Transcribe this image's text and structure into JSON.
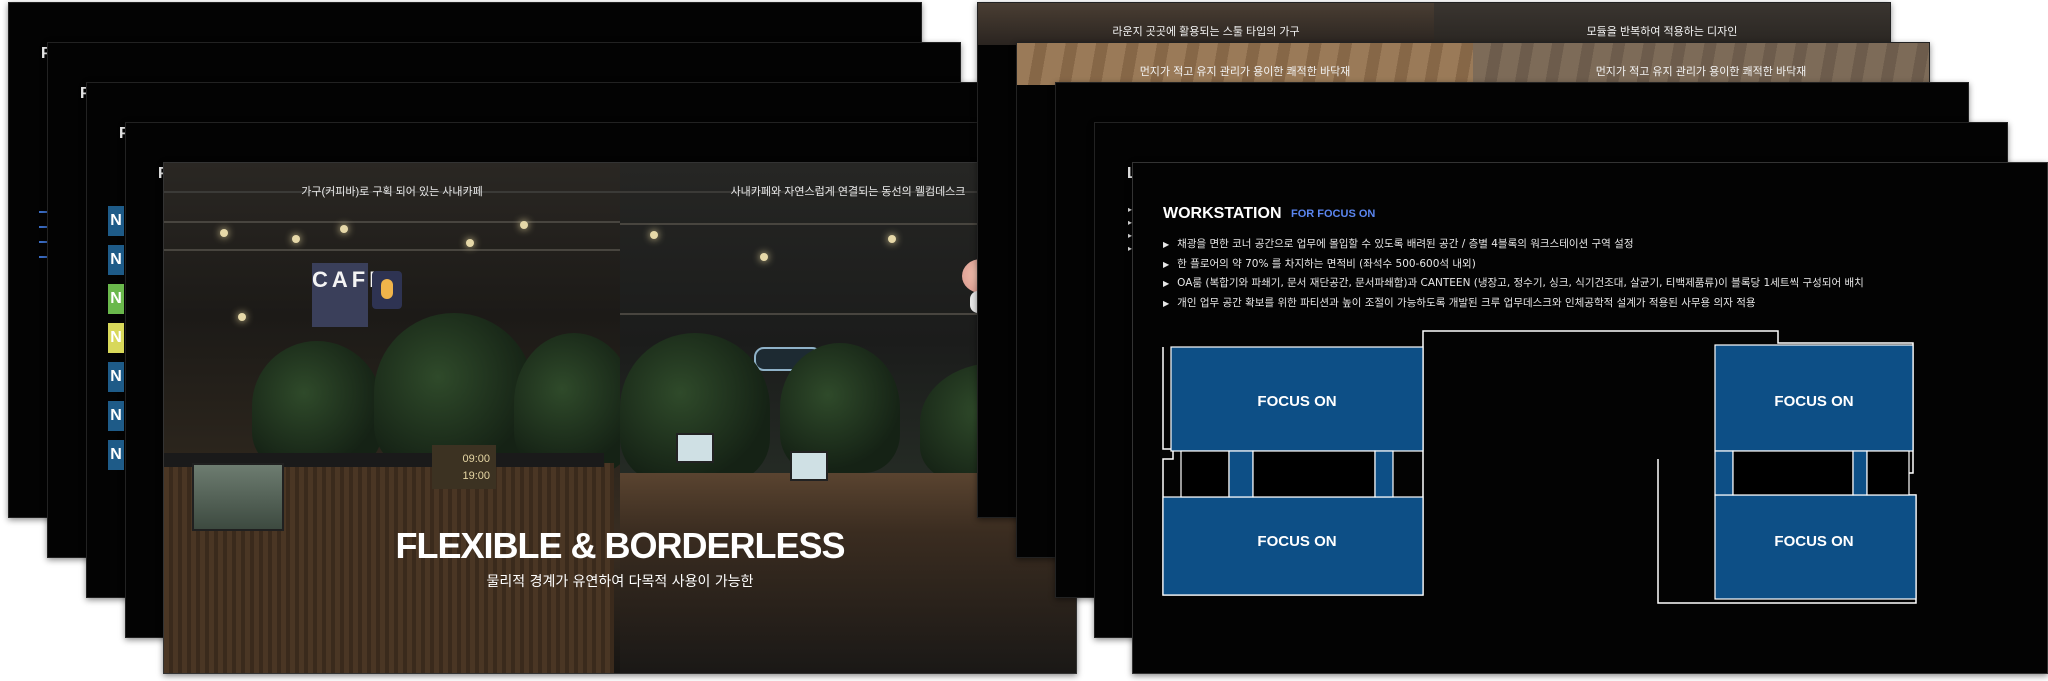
{
  "left_stack": {
    "peek_letter": "P",
    "tabs": [
      {
        "letter": "N",
        "color": "#1e5b88"
      },
      {
        "letter": "N",
        "color": "#1e5b88"
      },
      {
        "letter": "N",
        "color": "#6ab84c"
      },
      {
        "letter": "N",
        "color": "#d8d85a"
      },
      {
        "letter": "N",
        "color": "#1e5b88"
      },
      {
        "letter": "N",
        "color": "#1e5b88"
      },
      {
        "letter": "N",
        "color": "#1e5b88"
      }
    ]
  },
  "front_left": {
    "caption_left": "가구(커피바)로 구획 되어 있는 사내카페",
    "caption_right": "사내카페와 자연스럽게 연결되는 동선의 웰컴데스크",
    "cafe_sign": "CAFE",
    "clock_1": "09:00",
    "clock_2": "19:00",
    "headline": "FLEXIBLE & BORDERLESS",
    "subhead": "물리적 경계가 유연하여 다목적 사용이 가능한"
  },
  "right_stack": {
    "peek_letter": "L",
    "slide1_captions": [
      "라운지 곳곳에 활용되는 스툴 타입의 가구",
      "모듈을 반복하여 적용하는 디자인"
    ],
    "slide2_captions": [
      "먼지가 적고 유지 관리가 용이한 쾌적한 바닥재",
      "먼지가 적고 유지 관리가 용이한 쾌적한 바닥재"
    ]
  },
  "workstation": {
    "title": "WORKSTATION",
    "subtitle": "FOR FOCUS ON",
    "bullets": [
      "채광을 면한 코너 공간으로 업무에 몰입할 수 있도록 배려된 공간 / 층별 4블록의 워크스테이션 구역 설정",
      "한 플로어의 약 70% 를 차지하는 면적비 (좌석수 500-600석 내외)",
      "OA룸 (복합기와 파쇄기, 문서 재단공간, 문서파쇄함)과 CANTEEN (냉장고, 정수기, 싱크, 식기건조대, 살균기, 티백제품류)이 블록당 1세트씩 구성되어 배치",
      "개인 업무 공간 확보를 위한 파티션과 높이 조절이 가능하도록 개발된 크루 업무데스크와 인체공학적 설계가 적용된 사무용 의자 적용"
    ],
    "zones": [
      "FOCUS ON",
      "FOCUS ON",
      "FOCUS ON",
      "FOCUS ON"
    ],
    "zone_color": "#0d4f86"
  }
}
